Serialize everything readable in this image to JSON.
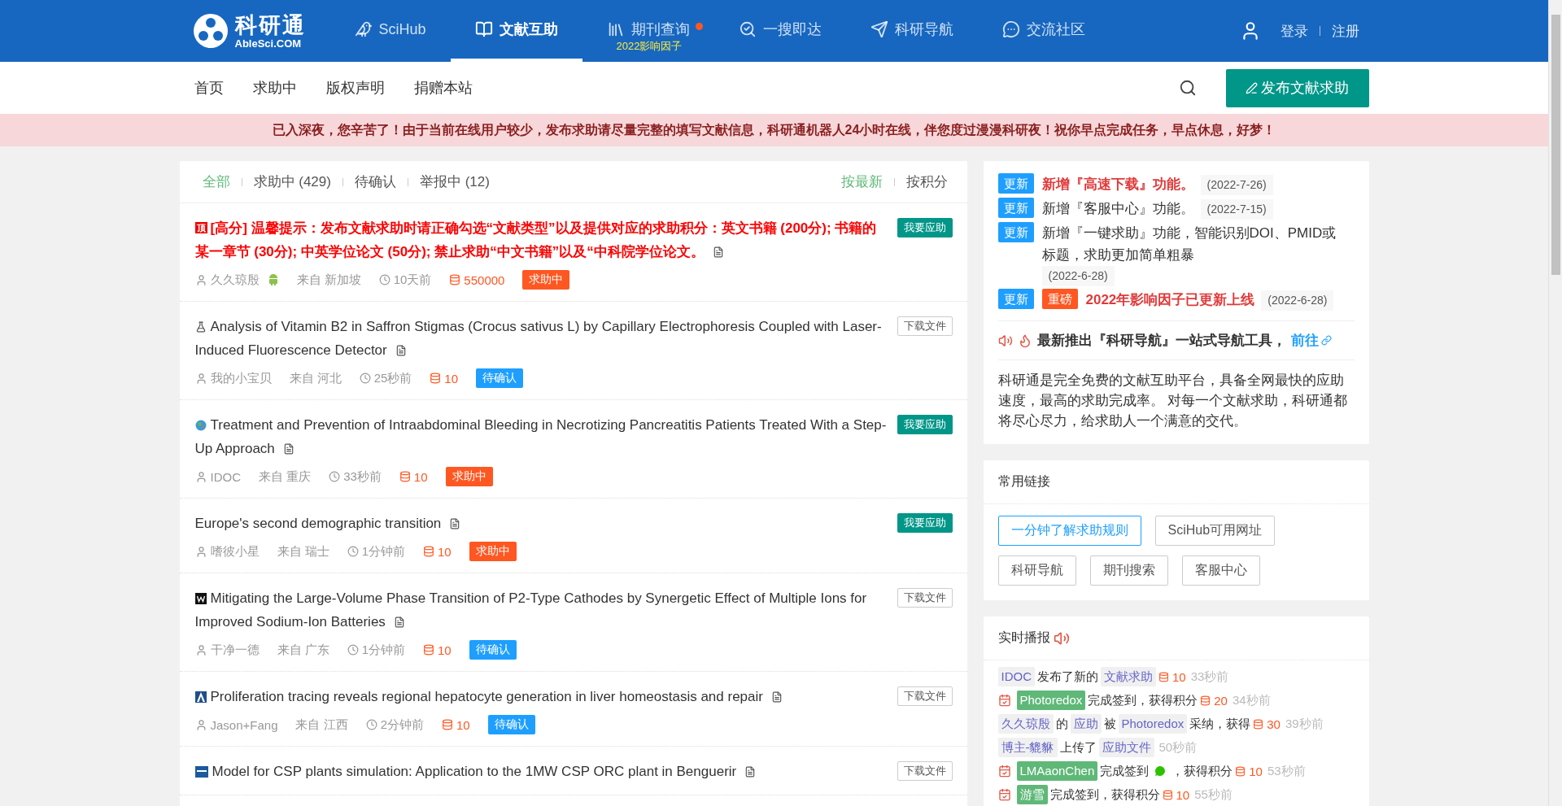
{
  "header": {
    "logo": {
      "name": "科研通",
      "domain": "AbleSci.COM"
    },
    "nav": [
      {
        "kind": "scihub",
        "label": "SciHub",
        "selected": false,
        "dot": false
      },
      {
        "kind": "book",
        "label": "文献互助",
        "selected": true,
        "dot": false
      },
      {
        "kind": "journal",
        "label": "期刊查询",
        "selected": false,
        "dot": true,
        "sub": "2022影响因子"
      },
      {
        "kind": "search",
        "label": "一搜即达",
        "selected": false,
        "dot": false
      },
      {
        "kind": "plane",
        "label": "科研导航",
        "selected": false,
        "dot": false
      },
      {
        "kind": "chat",
        "label": "交流社区",
        "selected": false,
        "dot": false
      }
    ],
    "account": [
      "登录",
      "注册"
    ]
  },
  "subnav": {
    "items": [
      "首页",
      "求助中",
      "版权声明",
      "捐赠本站"
    ],
    "action": "发布文献求助"
  },
  "notice": "已入深夜，您辛苦了！由于当前在线用户较少，发布求助请尽量完整的填写文献信息，科研通机器人24小时在线，伴您度过漫漫科研夜！祝你早点完成任务，早点休息，好梦！",
  "requests": {
    "filters": [
      {
        "label": "全部",
        "selected": true
      },
      {
        "label": "求助中 (429)",
        "selected": false
      },
      {
        "label": "待确认",
        "selected": false
      },
      {
        "label": "举报中 (12)",
        "selected": false
      }
    ],
    "sorts": [
      {
        "label": "按最新",
        "selected": true
      },
      {
        "label": "按积分",
        "selected": false
      }
    ],
    "items": [
      {
        "kind": "pin",
        "pin": "顶",
        "title": "[高分] 温馨提示：发布文献求助时请正确勾选“文献类型”以及提供对应的求助积分：英文书籍 (200分); 书籍的某一章节 (30分); 中英学位论文 (50分); 禁止求助“中文书籍”以及“中科院学位论文。",
        "urgent": true,
        "user": "久久琼殷",
        "android": true,
        "location": "来自 新加坡",
        "time": "10天前",
        "points": "550000",
        "status": {
          "kind": "seeking",
          "label": "求助中"
        },
        "action": {
          "kind": "respond",
          "label": "我要应助"
        }
      },
      {
        "kind": "flask",
        "title": "Analysis of Vitamin B2 in Saffron Stigmas (Crocus sativus L) by Capillary Electrophoresis Coupled with Laser-Induced Fluorescence Detector",
        "urgent": false,
        "user": "我的小宝贝",
        "android": false,
        "location": "来自 河北",
        "time": "25秒前",
        "points": "10",
        "status": {
          "kind": "pending",
          "label": "待确认"
        },
        "action": {
          "kind": "download",
          "label": "下载文件"
        }
      },
      {
        "kind": "globe",
        "title": "Treatment and Prevention of Intraabdominal Bleeding in Necrotizing Pancreatitis Patients Treated With a Step-Up Approach",
        "urgent": false,
        "user": "IDOC",
        "android": false,
        "location": "来自 重庆",
        "time": "33秒前",
        "points": "10",
        "status": {
          "kind": "seeking",
          "label": "求助中"
        },
        "action": {
          "kind": "respond",
          "label": "我要应助"
        }
      },
      {
        "kind": "plain",
        "title": "Europe's second demographic transition",
        "urgent": false,
        "user": "嗜彼小星",
        "android": false,
        "location": "来自 瑞士",
        "time": "1分钟前",
        "points": "10",
        "status": {
          "kind": "seeking",
          "label": "求助中"
        },
        "action": {
          "kind": "respond",
          "label": "我要应助"
        }
      },
      {
        "kind": "w-logo",
        "title": "Mitigating the Large-Volume Phase Transition of P2-Type Cathodes by Synergetic Effect of Multiple Ions for Improved Sodium-Ion Batteries",
        "urgent": false,
        "user": "干净一德",
        "android": false,
        "location": "来自 广东",
        "time": "1分钟前",
        "points": "10",
        "status": {
          "kind": "pending",
          "label": "待确认"
        },
        "action": {
          "kind": "download",
          "label": "下载文件"
        }
      },
      {
        "kind": "a-logo",
        "title": "Proliferation tracing reveals regional hepatocyte generation in liver homeostasis and repair",
        "urgent": false,
        "user": "Jason+Fang",
        "android": false,
        "location": "来自 江西",
        "time": "2分钟前",
        "points": "10",
        "status": {
          "kind": "pending",
          "label": "待确认"
        },
        "action": {
          "kind": "download",
          "label": "下载文件"
        }
      },
      {
        "kind": "ieee",
        "title": "Model for CSP plants simulation: Application to the 1MW CSP ORC plant in Benguerir",
        "urgent": false,
        "action": {
          "kind": "download",
          "label": "下载文件"
        }
      }
    ]
  },
  "updates": {
    "items": [
      {
        "tags": [
          {
            "kind": "update",
            "label": "更新"
          }
        ],
        "text": "新增『高速下载』功能。",
        "highlight": true,
        "date": "(2022-7-26)"
      },
      {
        "tags": [
          {
            "kind": "update",
            "label": "更新"
          }
        ],
        "text": "新增『客服中心』功能。",
        "highlight": false,
        "date": "(2022-7-15)"
      },
      {
        "tags": [
          {
            "kind": "update",
            "label": "更新"
          }
        ],
        "text": "新增『一键求助』功能，智能识别DOI、PMID或标题，求助更加简单粗暴",
        "highlight": false,
        "date": "(2022-6-28)"
      },
      {
        "tags": [
          {
            "kind": "update",
            "label": "更新"
          },
          {
            "kind": "major",
            "label": "重磅"
          }
        ],
        "text": "2022年影响因子已更新上线",
        "highlight": true,
        "date": "(2022-6-28)"
      }
    ],
    "promo": {
      "text": "最新推出『科研导航』一站式导航工具，",
      "link": "前往"
    },
    "about": "科研通是完全免费的文献互助平台，具备全网最快的应助速度，最高的求助完成率。 对每一个文献求助，科研通都将尽心尽力，给求助人一个满意的交代。"
  },
  "links": {
    "title": "常用链接",
    "items": [
      {
        "label": "一分钟了解求助规则",
        "selected": true
      },
      {
        "label": "SciHub可用网址",
        "selected": false
      },
      {
        "label": "科研导航",
        "selected": false
      },
      {
        "label": "期刊搜索",
        "selected": false
      },
      {
        "label": "客服中心",
        "selected": false
      }
    ]
  },
  "feed": {
    "title": "实时播报",
    "items": [
      {
        "checkin": false,
        "segments": [
          {
            "kind": "tag",
            "text": "IDOC"
          },
          {
            "kind": "text",
            "text": "发布了新的"
          },
          {
            "kind": "tag",
            "text": "文献求助"
          },
          {
            "kind": "points",
            "text": "10"
          },
          {
            "kind": "time",
            "text": "33秒前"
          }
        ]
      },
      {
        "checkin": true,
        "segments": [
          {
            "kind": "user",
            "text": "Photoredox"
          },
          {
            "kind": "text",
            "text": "完成签到，获得积分"
          },
          {
            "kind": "points",
            "text": "20"
          },
          {
            "kind": "time",
            "text": "34秒前"
          }
        ]
      },
      {
        "checkin": false,
        "segments": [
          {
            "kind": "tag",
            "text": "久久琼殷"
          },
          {
            "kind": "text",
            "text": "的"
          },
          {
            "kind": "tag",
            "text": "应助"
          },
          {
            "kind": "text",
            "text": "被"
          },
          {
            "kind": "tag",
            "text": "Photoredox"
          },
          {
            "kind": "text",
            "text": "采纳，获得"
          },
          {
            "kind": "points",
            "text": "30"
          },
          {
            "kind": "time",
            "text": "39秒前"
          }
        ]
      },
      {
        "checkin": false,
        "segments": [
          {
            "kind": "tag",
            "text": "博主-貔貅"
          },
          {
            "kind": "text",
            "text": "上传了"
          },
          {
            "kind": "tag",
            "text": "应助文件"
          },
          {
            "kind": "time",
            "text": "50秒前"
          }
        ]
      },
      {
        "checkin": true,
        "segments": [
          {
            "kind": "user",
            "text": "LMAaonChen"
          },
          {
            "kind": "text",
            "text": "完成签到"
          },
          {
            "kind": "wechat"
          },
          {
            "kind": "text",
            "text": "，获得积分"
          },
          {
            "kind": "points",
            "text": "10"
          },
          {
            "kind": "time",
            "text": "53秒前"
          }
        ]
      },
      {
        "checkin": true,
        "segments": [
          {
            "kind": "user",
            "text": "游雪"
          },
          {
            "kind": "text",
            "text": "完成签到，获得积分"
          },
          {
            "kind": "points",
            "text": "10"
          },
          {
            "kind": "time",
            "text": "55秒前"
          }
        ]
      }
    ]
  }
}
